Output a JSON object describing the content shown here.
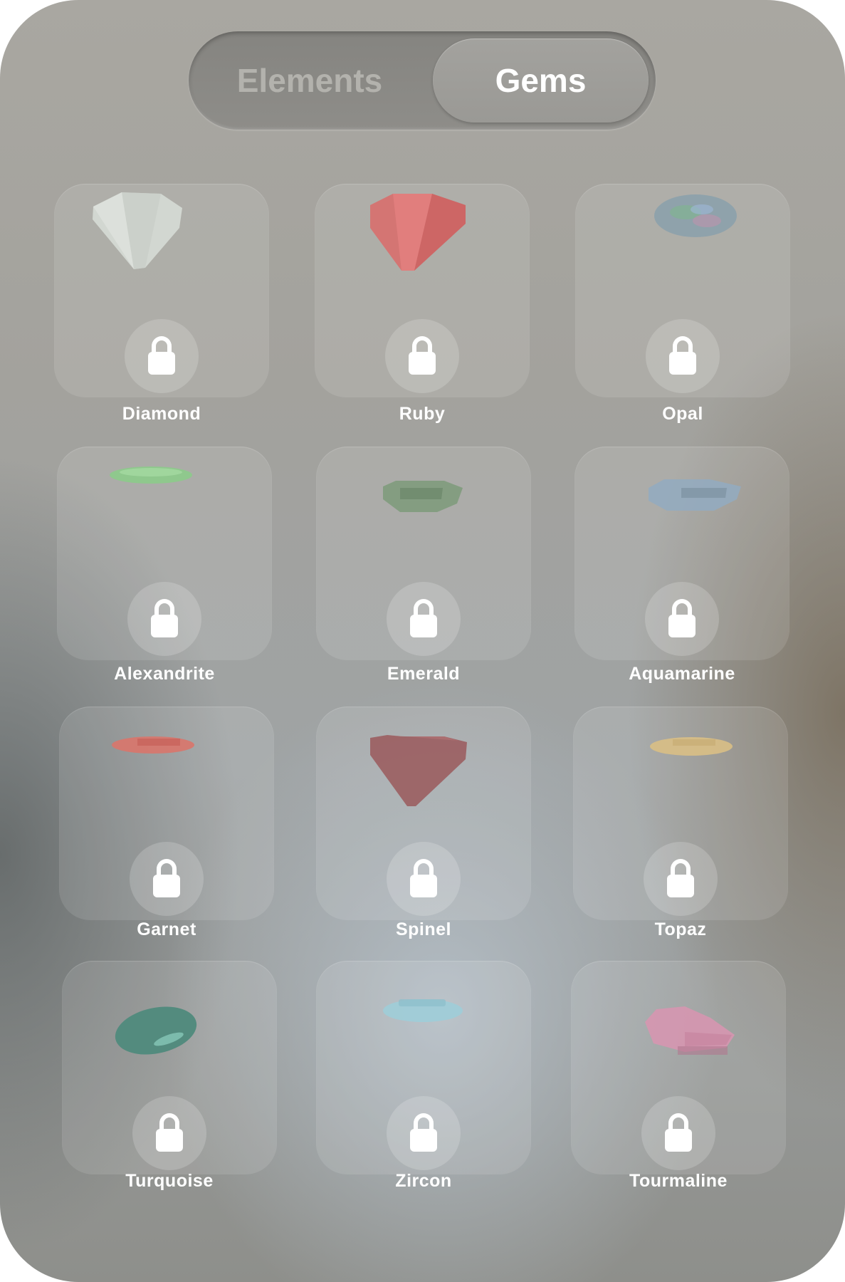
{
  "segmented_control": {
    "tabs": [
      {
        "label": "Elements",
        "selected": false
      },
      {
        "label": "Gems",
        "selected": true
      }
    ]
  },
  "gems": [
    {
      "name": "Diamond",
      "locked": true,
      "color": "#d3d8d3"
    },
    {
      "name": "Ruby",
      "locked": true,
      "color": "#d9716f"
    },
    {
      "name": "Opal",
      "locked": true,
      "color": "#8fa3b0"
    },
    {
      "name": "Alexandrite",
      "locked": true,
      "color": "#8ccb8a"
    },
    {
      "name": "Emerald",
      "locked": true,
      "color": "#7f9b7c"
    },
    {
      "name": "Aquamarine",
      "locked": true,
      "color": "#93abbf"
    },
    {
      "name": "Garnet",
      "locked": true,
      "color": "#d9756c"
    },
    {
      "name": "Spinel",
      "locked": true,
      "color": "#9b5e60"
    },
    {
      "name": "Topaz",
      "locked": true,
      "color": "#d9bf85"
    },
    {
      "name": "Turquoise",
      "locked": true,
      "color": "#4f8a7c"
    },
    {
      "name": "Zircon",
      "locked": true,
      "color": "#9fcdd8"
    },
    {
      "name": "Tourmaline",
      "locked": true,
      "color": "#d696b0"
    }
  ]
}
